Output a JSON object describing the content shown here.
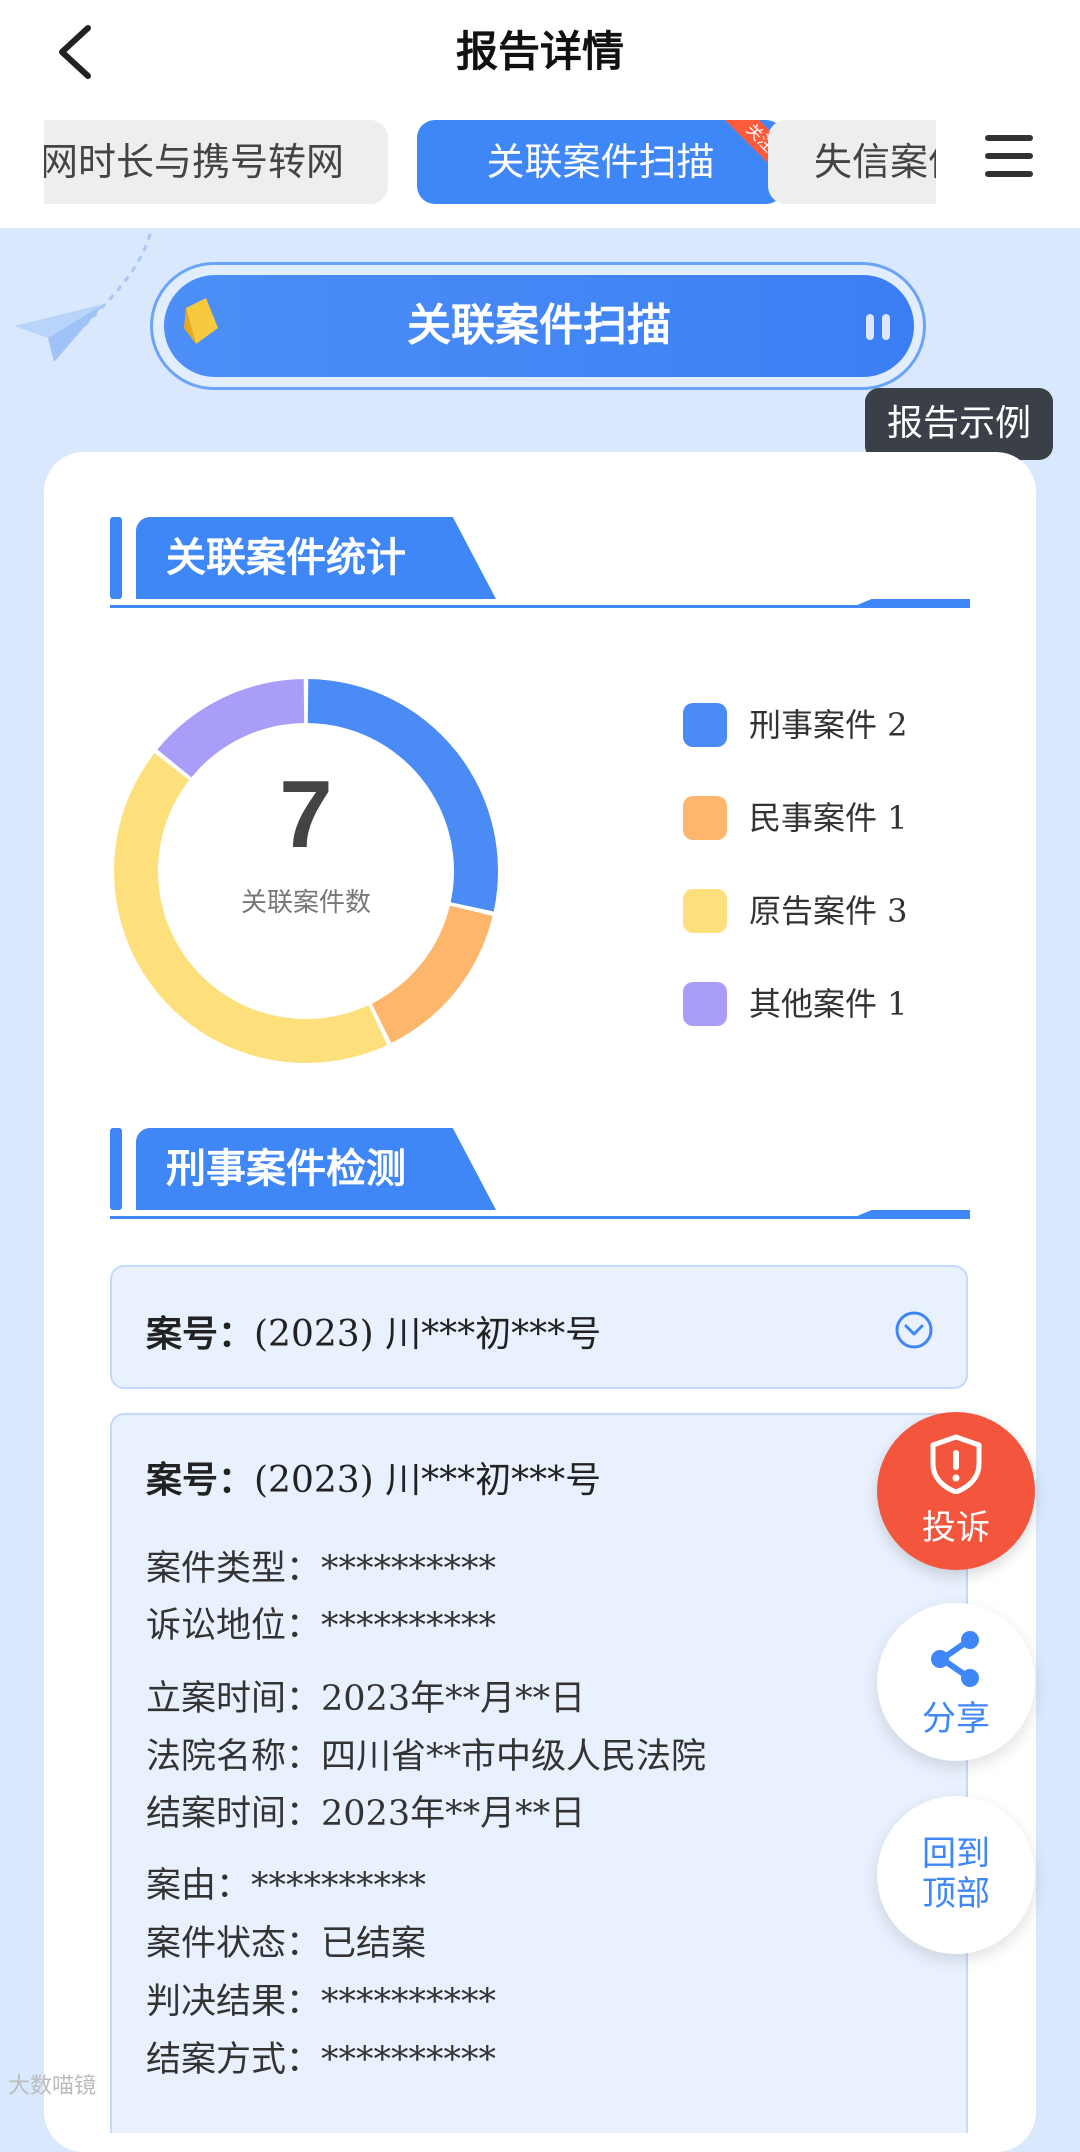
{
  "header": {
    "title": "报告详情",
    "tabs": [
      {
        "label": "网时长与携号转网"
      },
      {
        "label": "关联案件扫描",
        "ribbon": "关注"
      },
      {
        "label": "失信案件"
      }
    ]
  },
  "banner": {
    "title": "关联案件扫描",
    "example_button": "报告示例"
  },
  "stats_section": {
    "title": "关联案件统计"
  },
  "chart_data": {
    "type": "pie",
    "center_value": "7",
    "center_label": "关联案件数",
    "categories": [
      "刑事案件",
      "民事案件",
      "原告案件",
      "其他案件"
    ],
    "values": [
      2,
      1,
      3,
      1
    ],
    "colors": [
      "#4a8bf6",
      "#fdb66c",
      "#fde07c",
      "#a99ef7"
    ]
  },
  "legend": [
    {
      "label": "刑事案件 2",
      "color": "#4a8bf6"
    },
    {
      "label": "民事案件 1",
      "color": "#fdb66c"
    },
    {
      "label": "原告案件 3",
      "color": "#fde07c"
    },
    {
      "label": "其他案件 1",
      "color": "#a99ef7"
    }
  ],
  "criminal_section": {
    "title": "刑事案件检测"
  },
  "case_collapsed": {
    "key": "案号：",
    "value": "(2023) 川***初***号"
  },
  "case_expanded": {
    "case_no_key": "案号：",
    "case_no_value": "(2023) 川***初***号",
    "fields": [
      {
        "key": "案件类型：",
        "value": "**********"
      },
      {
        "key": "诉讼地位：",
        "value": "**********"
      },
      {
        "key": "立案时间：",
        "value": "2023年**月**日"
      },
      {
        "key": "法院名称：",
        "value": "四川省**市中级人民法院"
      },
      {
        "key": "结案时间：",
        "value": "2023年**月**日"
      },
      {
        "key": "案由：",
        "value": "**********"
      },
      {
        "key": "案件状态：",
        "value": "已结案"
      },
      {
        "key": "判决结果：",
        "value": "**********"
      },
      {
        "key": "结案方式：",
        "value": "**********"
      }
    ]
  },
  "fabs": {
    "complaint": "投诉",
    "share": "分享",
    "top_line1": "回到",
    "top_line2": "顶部"
  },
  "watermark": "大数喵镜",
  "colors": {
    "primary": "#3f86f6",
    "danger": "#f3553d",
    "page_bg": "#d9e8fd"
  }
}
